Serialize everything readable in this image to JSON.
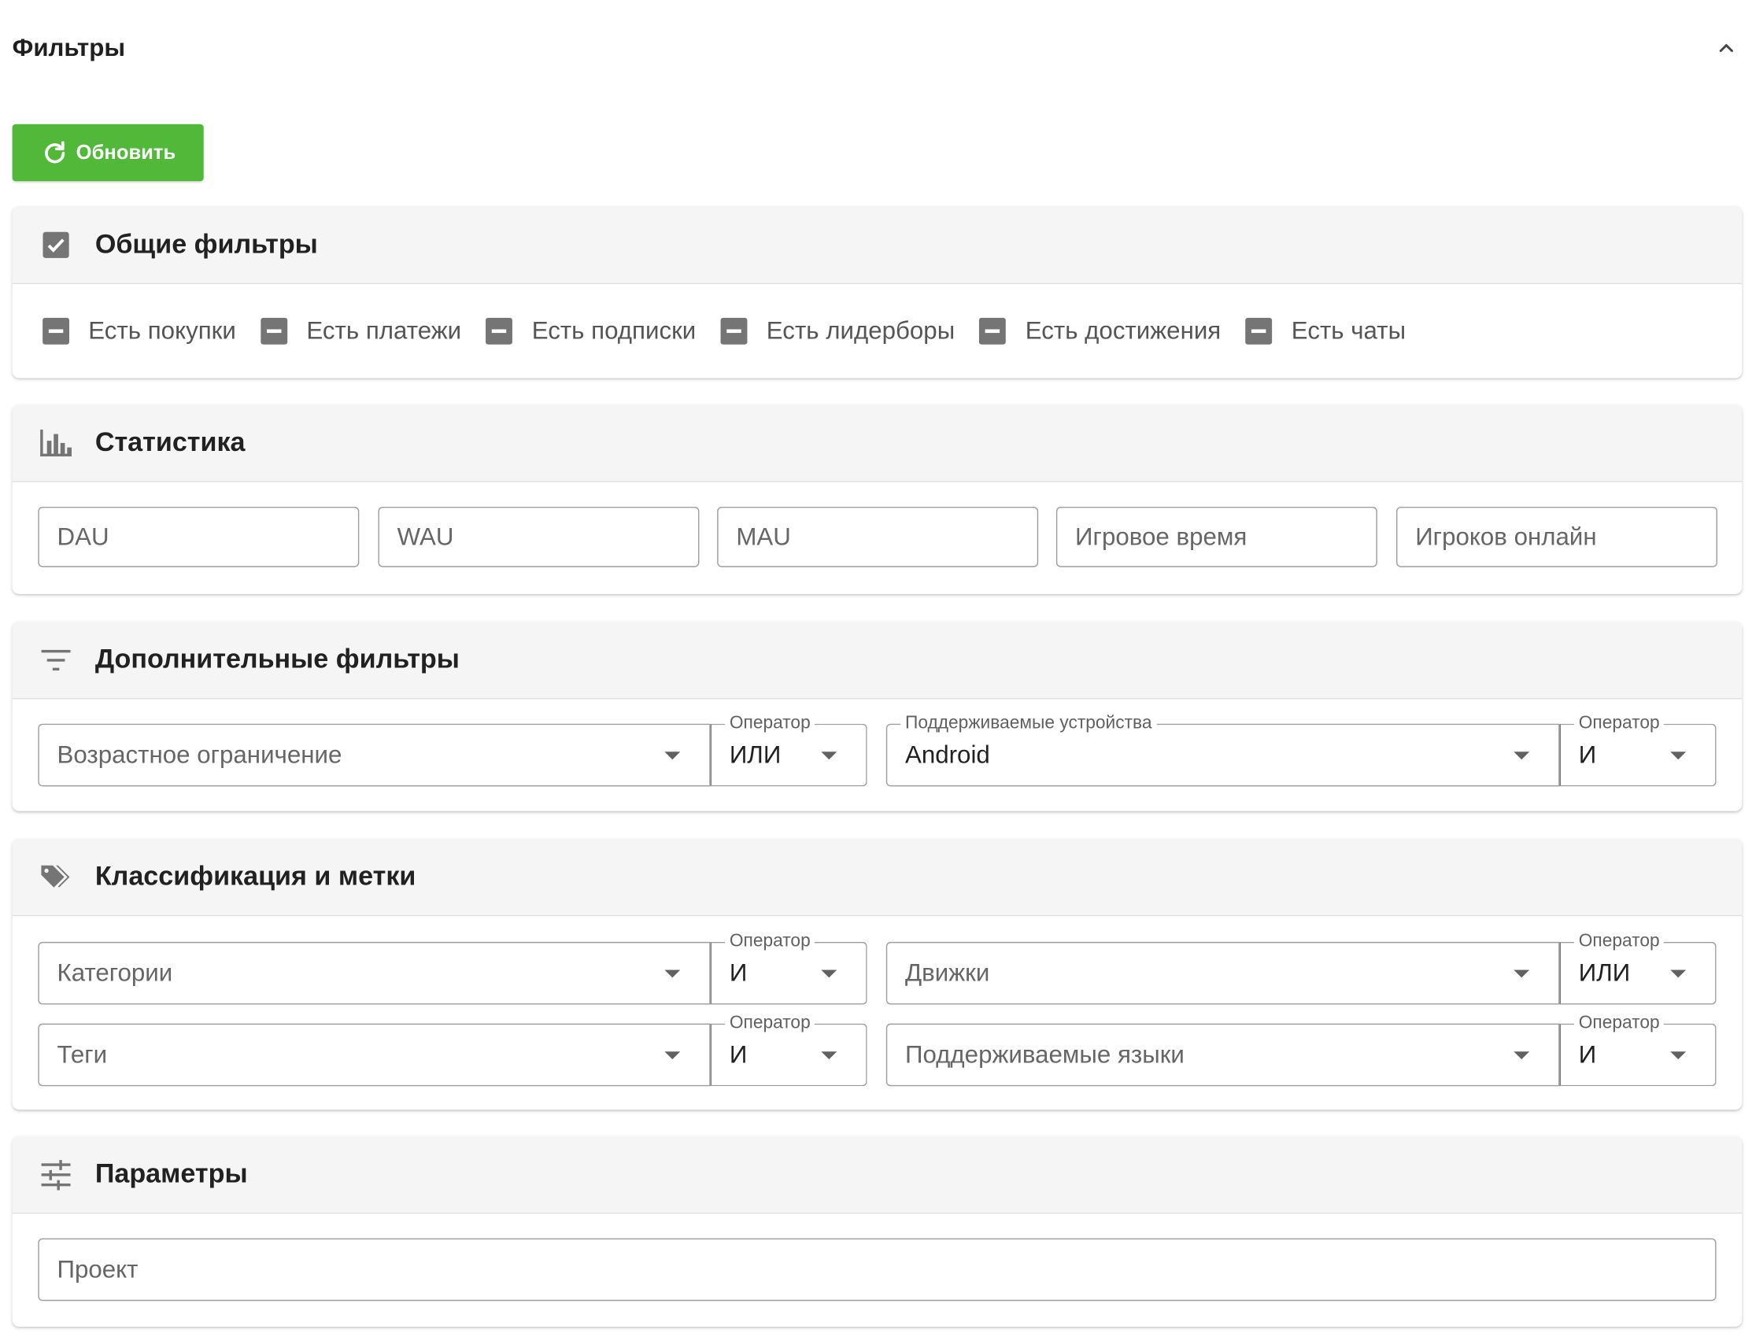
{
  "header": {
    "title": "Фильтры"
  },
  "refresh_button": {
    "label": "Обновить"
  },
  "general": {
    "title": "Общие фильтры",
    "checks": [
      {
        "label": "Есть покупки"
      },
      {
        "label": "Есть платежи"
      },
      {
        "label": "Есть подписки"
      },
      {
        "label": "Есть лидерборы"
      },
      {
        "label": "Есть достижения"
      },
      {
        "label": "Есть чаты"
      }
    ]
  },
  "stats": {
    "title": "Статистика",
    "fields": [
      {
        "placeholder": "DAU"
      },
      {
        "placeholder": "WAU"
      },
      {
        "placeholder": "MAU"
      },
      {
        "placeholder": "Игровое время"
      },
      {
        "placeholder": "Игроков онлайн"
      }
    ]
  },
  "additional": {
    "title": "Дополнительные фильтры",
    "age": {
      "placeholder": "Возрастное ограничение",
      "operator_label": "Оператор",
      "operator_value": "ИЛИ"
    },
    "devices": {
      "label": "Поддерживаемые устройства",
      "value": "Android",
      "operator_label": "Оператор",
      "operator_value": "И"
    }
  },
  "classification": {
    "title": "Классификация и метки",
    "categories": {
      "placeholder": "Категории",
      "operator_label": "Оператор",
      "operator_value": "И"
    },
    "engines": {
      "placeholder": "Движки",
      "operator_label": "Оператор",
      "operator_value": "ИЛИ"
    },
    "tags": {
      "placeholder": "Теги",
      "operator_label": "Оператор",
      "operator_value": "И"
    },
    "languages": {
      "placeholder": "Поддерживаемые языки",
      "operator_label": "Оператор",
      "operator_value": "И"
    }
  },
  "params": {
    "title": "Параметры",
    "project": {
      "placeholder": "Проект"
    }
  },
  "colors": {
    "accent_green": "#52b83a",
    "icon_gray": "#757575"
  }
}
